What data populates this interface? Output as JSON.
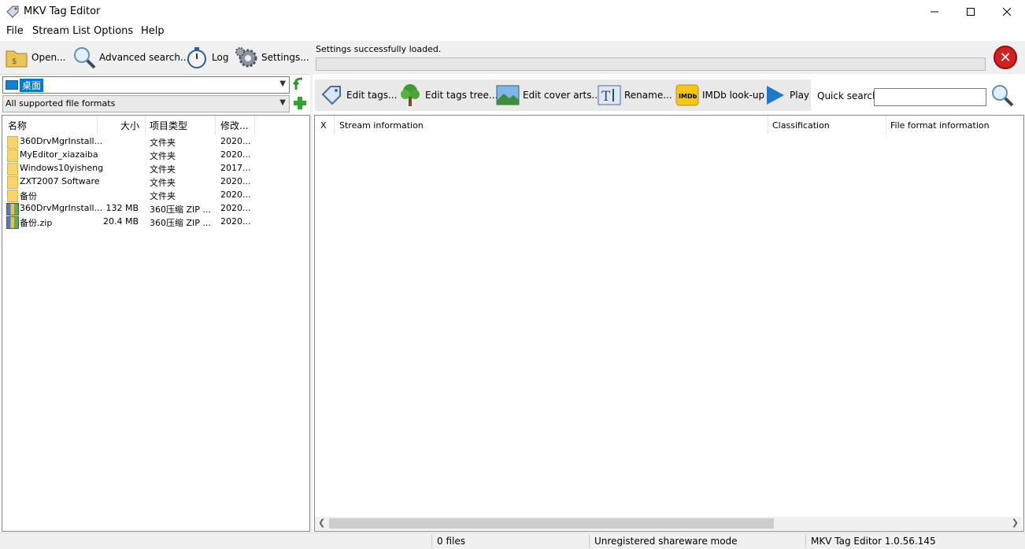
{
  "window": {
    "title": "MKV Tag Editor"
  },
  "menu": [
    "File",
    "Stream List",
    "Options",
    "Help"
  ],
  "left_toolbar": {
    "open": "Open...",
    "advanced_search": "Advanced search...",
    "log": "Log",
    "settings": "Settings..."
  },
  "status": {
    "message": "Settings successfully loaded."
  },
  "folder": {
    "current": "桌面",
    "format_filter": "All supported file formats"
  },
  "file_list": {
    "headers": [
      "名称",
      "大小",
      "项目类型",
      "修改..."
    ],
    "rows": [
      {
        "name": "360DrvMgrInstall...",
        "size": "",
        "type": "文件夹",
        "modified": "2020...",
        "kind": "folder"
      },
      {
        "name": "MyEditor_xiazaiba",
        "size": "",
        "type": "文件夹",
        "modified": "2020...",
        "kind": "folder"
      },
      {
        "name": "Windows10yisheng",
        "size": "",
        "type": "文件夹",
        "modified": "2017...",
        "kind": "folder"
      },
      {
        "name": "ZXT2007 Software",
        "size": "",
        "type": "文件夹",
        "modified": "2020...",
        "kind": "folder"
      },
      {
        "name": "备份",
        "size": "",
        "type": "文件夹",
        "modified": "2020...",
        "kind": "folder"
      },
      {
        "name": "360DrvMgrInstall...",
        "size": "132 MB",
        "type": "360压缩 ZIP ...",
        "modified": "2020...",
        "kind": "zip"
      },
      {
        "name": "备份.zip",
        "size": "20.4 MB",
        "type": "360压缩 ZIP ...",
        "modified": "2020...",
        "kind": "zip"
      }
    ]
  },
  "right_toolbar": {
    "edit_tags": "Edit tags...",
    "edit_tags_tree": "Edit tags tree...",
    "edit_cover_arts": "Edit cover arts...",
    "rename": "Rename...",
    "imdb": "IMDb look-up",
    "play": "Play",
    "quick_search_label": "Quick search:",
    "quick_search_value": ""
  },
  "stream_grid": {
    "headers": [
      "X",
      "Stream information",
      "Classification",
      "File format information"
    ]
  },
  "statusbar": {
    "files": "0 files",
    "mode": "Unregistered shareware mode",
    "version": "MKV Tag Editor 1.0.56.145"
  },
  "colors": {
    "accent": "#0078d7",
    "stop": "#d32020"
  }
}
